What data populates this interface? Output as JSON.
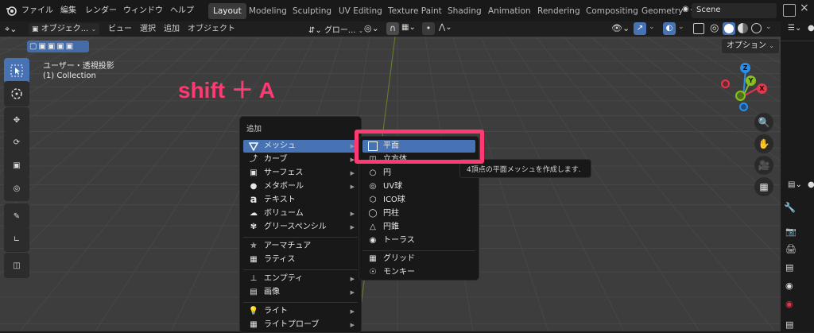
{
  "topbar": {
    "menus": [
      "ファイル",
      "編集",
      "レンダー",
      "ウィンドウ",
      "ヘルプ"
    ],
    "workspaces": [
      "Layout",
      "Modeling",
      "Sculpting",
      "UV Editing",
      "Texture Paint",
      "Shading",
      "Animation",
      "Rendering",
      "Compositing",
      "Geometry"
    ],
    "active_workspace": "Layout",
    "scene": "Scene"
  },
  "header": {
    "mode": "オブジェク...",
    "view": "ビュー",
    "select": "選択",
    "add": "追加",
    "object": "オブジェクト",
    "transform": "グロー...",
    "options": "オプション"
  },
  "viewport": {
    "view_name": "ユーザー・透視投影",
    "collection": "(1) Collection",
    "overlay_text": "shift ＋ A"
  },
  "add_menu": {
    "title": "追加",
    "items": [
      {
        "label": "メッシュ",
        "submenu": true,
        "icon": "mesh-icon"
      },
      {
        "label": "カーブ",
        "submenu": true,
        "icon": "curve-icon"
      },
      {
        "label": "サーフェス",
        "submenu": true,
        "icon": "surface-icon"
      },
      {
        "label": "メタボール",
        "submenu": true,
        "icon": "metaball-icon"
      },
      {
        "label": "テキスト",
        "submenu": false,
        "icon": "text-icon"
      },
      {
        "label": "ボリューム",
        "submenu": true,
        "icon": "volume-icon"
      },
      {
        "label": "グリースペンシル",
        "submenu": true,
        "icon": "grease-pencil-icon"
      },
      {
        "label": "アーマチュア",
        "submenu": false,
        "icon": "armature-icon"
      },
      {
        "label": "ラティス",
        "submenu": false,
        "icon": "lattice-icon"
      },
      {
        "label": "エンプティ",
        "submenu": true,
        "icon": "empty-icon"
      },
      {
        "label": "画像",
        "submenu": true,
        "icon": "image-icon"
      },
      {
        "label": "ライト",
        "submenu": true,
        "icon": "light-icon"
      },
      {
        "label": "ライトプローブ",
        "submenu": true,
        "icon": "light-probe-icon"
      }
    ]
  },
  "mesh_menu": {
    "items": [
      {
        "label": "平面",
        "icon": "plane-icon"
      },
      {
        "label": "立方体",
        "icon": "cube-icon"
      },
      {
        "label": "円",
        "icon": "circle-icon"
      },
      {
        "label": "UV球",
        "icon": "uv-sphere-icon"
      },
      {
        "label": "ICO球",
        "icon": "ico-sphere-icon"
      },
      {
        "label": "円柱",
        "icon": "cylinder-icon"
      },
      {
        "label": "円錐",
        "icon": "cone-icon"
      },
      {
        "label": "トーラス",
        "icon": "torus-icon"
      },
      {
        "label": "グリッド",
        "icon": "grid-icon"
      },
      {
        "label": "モンキー",
        "icon": "monkey-icon"
      }
    ]
  },
  "tooltip": "4頂点の平面メッシュを作成します.",
  "colors": {
    "accent": "#4772b3",
    "highlight": "#ff3a73",
    "axis_x": "#e2374c",
    "axis_y": "#85c01c",
    "axis_z": "#2c8ee8"
  },
  "gizmo": {
    "x": "X",
    "y": "Y",
    "z": "Z"
  }
}
